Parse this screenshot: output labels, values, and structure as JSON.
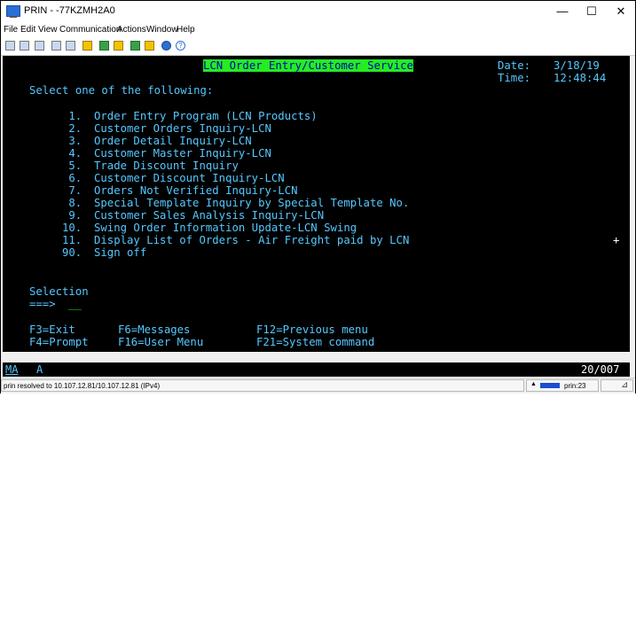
{
  "window": {
    "title": "PRIN - -77KZMH2A0",
    "minimize": "—",
    "maximize": "☐",
    "close": "✕"
  },
  "menu": {
    "items": [
      "File",
      "Edit",
      "View",
      "Communication",
      "Actions",
      "Window",
      "Help"
    ]
  },
  "toolbar": {
    "icons": [
      "copy-icon",
      "paste-icon",
      "print-icon",
      "screen-icon",
      "keyboard-icon",
      "macro-icon",
      "send-file-icon",
      "receive-file-icon",
      "transfer-icon",
      "transfer2-icon",
      "network-icon",
      "help-icon"
    ]
  },
  "screen": {
    "header_title": "LCN Order Entry/Customer Service",
    "date_label": "Date:",
    "date_value": "3/18/19",
    "time_label": "Time:",
    "time_value": "12:48:44",
    "prompt": "Select one of the following:",
    "options": [
      {
        "num": " 1.",
        "label": "Order Entry Program (LCN Products)"
      },
      {
        "num": " 2.",
        "label": "Customer Orders Inquiry-LCN"
      },
      {
        "num": " 3.",
        "label": "Order Detail Inquiry-LCN"
      },
      {
        "num": " 4.",
        "label": "Customer Master Inquiry-LCN"
      },
      {
        "num": " 5.",
        "label": "Trade Discount Inquiry"
      },
      {
        "num": " 6.",
        "label": "Customer Discount Inquiry-LCN"
      },
      {
        "num": " 7.",
        "label": "Orders Not Verified Inquiry-LCN"
      },
      {
        "num": " 8.",
        "label": "Special Template Inquiry by Special Template No."
      },
      {
        "num": " 9.",
        "label": "Customer Sales Analysis Inquiry-LCN"
      },
      {
        "num": "10.",
        "label": "Swing Order Information Update-LCN Swing"
      },
      {
        "num": "11.",
        "label": "Display List of Orders - Air Freight paid by LCN"
      },
      {
        "num": "90.",
        "label": "Sign off"
      }
    ],
    "plus_marker": "+",
    "selection_label": "Selection",
    "selection_arrow": "===>",
    "selection_value": "__",
    "fkeys_row1": [
      "F3=Exit",
      "F6=Messages",
      "F12=Previous menu"
    ],
    "fkeys_row2": [
      "F4=Prompt",
      "F16=User Menu",
      "F21=System command"
    ]
  },
  "oia": {
    "indicator": "MA",
    "mode": "A",
    "cursor_pos": "20/007"
  },
  "status": {
    "message": "prin resolved to 10.107.12.81/10.107.12.81 (IPv4)",
    "host": "prin:23"
  },
  "colors": {
    "screen_bg": "#000000",
    "text_green": "#22ee22",
    "text_cyan": "#55c8ff",
    "highlight_bg": "#22ee22"
  }
}
